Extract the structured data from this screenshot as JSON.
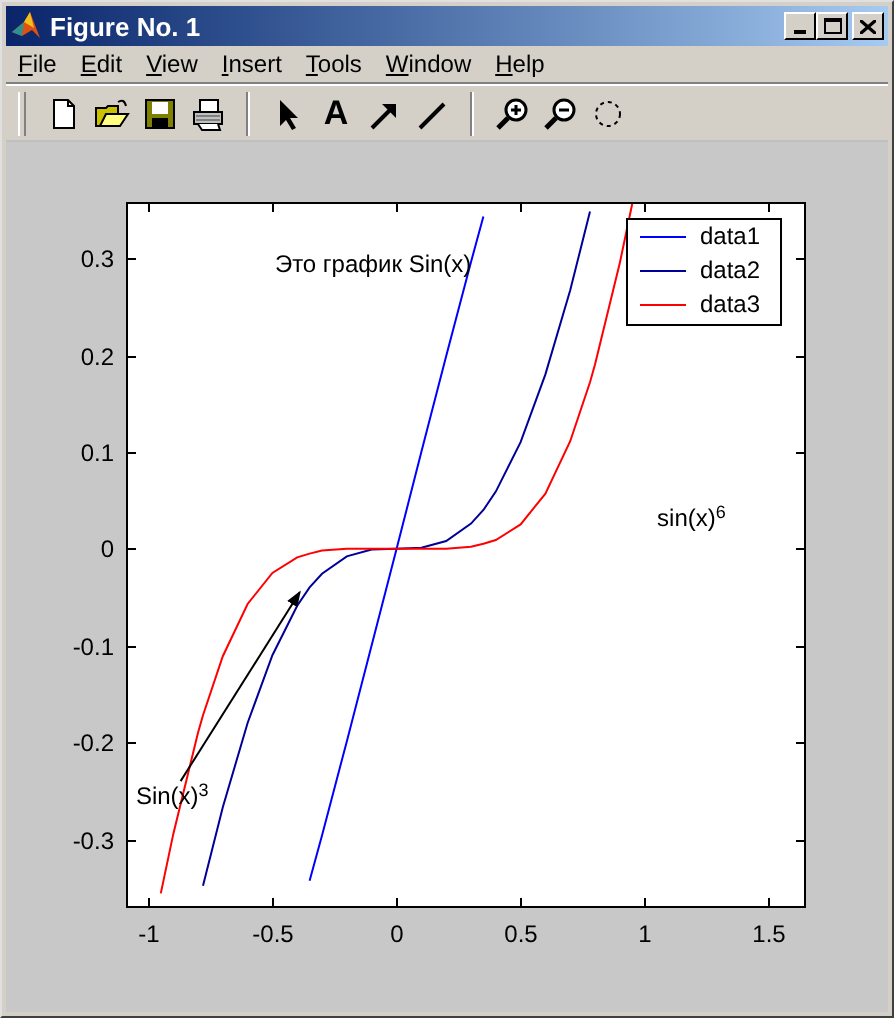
{
  "window": {
    "title": "Figure No. 1"
  },
  "menu": [
    "File",
    "Edit",
    "View",
    "Insert",
    "Tools",
    "Window",
    "Help"
  ],
  "toolbar": [
    {
      "kind": "new"
    },
    {
      "kind": "open"
    },
    {
      "kind": "save"
    },
    {
      "kind": "print"
    },
    {
      "kind": "separator"
    },
    {
      "kind": "pointer"
    },
    {
      "kind": "text",
      "label": "A"
    },
    {
      "kind": "arrow"
    },
    {
      "kind": "line"
    },
    {
      "kind": "separator"
    },
    {
      "kind": "zoom-in"
    },
    {
      "kind": "zoom-out"
    },
    {
      "kind": "rotate"
    }
  ],
  "axes": {
    "chart_data": {
      "type": "line",
      "x": [
        -0.95,
        -0.9,
        -0.8,
        -0.78,
        -0.7,
        -0.6,
        -0.5,
        -0.4,
        -0.35,
        -0.3,
        -0.2,
        -0.1,
        0,
        0.1,
        0.2,
        0.3,
        0.35,
        0.4,
        0.5,
        0.6,
        0.7,
        0.78,
        0.8,
        0.9,
        0.95
      ],
      "series": [
        {
          "name": "data1",
          "color": "#0000ff",
          "values": [
            null,
            null,
            null,
            null,
            null,
            null,
            null,
            null,
            -0.343,
            -0.296,
            -0.199,
            -0.1,
            0,
            0.1,
            0.199,
            0.296,
            0.343,
            null,
            null,
            null,
            null,
            null,
            null,
            null,
            null
          ]
        },
        {
          "name": "data2",
          "color": "#000099",
          "values": [
            null,
            null,
            null,
            -0.348,
            -0.267,
            -0.18,
            -0.11,
            -0.059,
            -0.04,
            -0.026,
            -0.008,
            -0.001,
            0,
            0.001,
            0.008,
            0.026,
            0.04,
            0.059,
            0.11,
            0.18,
            0.267,
            0.348,
            null,
            null,
            null
          ]
        },
        {
          "name": "data3",
          "color": "#ff0000",
          "values": [
            -0.356,
            -0.295,
            -0.19,
            -0.172,
            -0.111,
            -0.057,
            -0.025,
            -0.009,
            -0.005,
            -0.002,
            0,
            0,
            0,
            0,
            0,
            0.002,
            0.005,
            0.009,
            0.025,
            0.057,
            0.111,
            0.172,
            0.19,
            0.295,
            0.356
          ]
        }
      ],
      "xlim": [
        -1.09,
        1.65
      ],
      "ylim": [
        -0.371,
        0.358
      ],
      "xticks": [
        -1,
        -0.5,
        0,
        0.5,
        1,
        1.5
      ],
      "yticks": [
        -0.3,
        -0.2,
        -0.1,
        0,
        0.1,
        0.2,
        0.3
      ],
      "legend": true,
      "annotations": [
        "Это график Sin(x)",
        "sin(x)$^{6}$",
        "Sin(x)$^{3}$"
      ]
    }
  }
}
